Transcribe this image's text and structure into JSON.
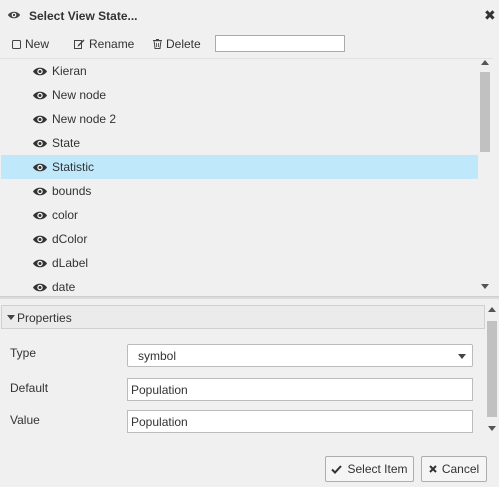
{
  "dialog": {
    "title": "Select View State...",
    "close_glyph": "✖"
  },
  "toolbar": {
    "new_label": "New",
    "rename_label": "Rename",
    "delete_label": "Delete",
    "search_value": "",
    "search_placeholder": ""
  },
  "list": {
    "items": [
      {
        "label": "Kieran"
      },
      {
        "label": "New node"
      },
      {
        "label": "New node 2"
      },
      {
        "label": "State"
      },
      {
        "label": "Statistic",
        "selected": true
      },
      {
        "label": "bounds"
      },
      {
        "label": "color"
      },
      {
        "label": "dColor"
      },
      {
        "label": "dLabel"
      },
      {
        "label": "date"
      }
    ]
  },
  "properties": {
    "header": "Properties",
    "type_label": "Type",
    "type_value": "symbol",
    "default_label": "Default",
    "default_value": "Population",
    "value_label": "Value",
    "value_value": "Population"
  },
  "buttons": {
    "select_label": "Select Item",
    "cancel_label": "Cancel"
  },
  "colors": {
    "selected_row": "#bfe8fb",
    "background": "#f0f0f0"
  },
  "icons": {
    "title": "eye-icon",
    "row": "eye-icon",
    "new": "square-icon",
    "rename": "edit-icon",
    "delete": "trash-icon",
    "search": "search-icon",
    "select": "check-icon",
    "cancel": "x-icon"
  }
}
